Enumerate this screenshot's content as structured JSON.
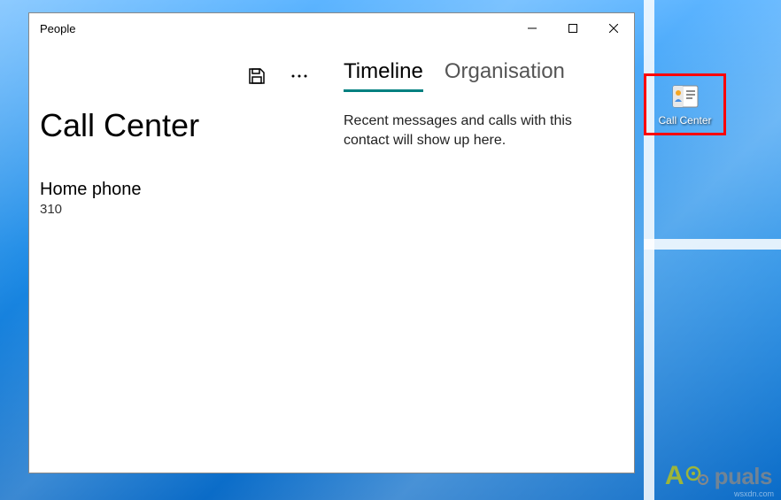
{
  "app": {
    "title": "People"
  },
  "contact": {
    "name": "Call Center",
    "fields": [
      {
        "label": "Home phone",
        "value": "310"
      }
    ]
  },
  "tabs": {
    "timeline": "Timeline",
    "organisation": "Organisation"
  },
  "timeline_content": "Recent messages and calls with this contact will show up here.",
  "desktop_icon": {
    "label": "Call Center"
  },
  "watermark": {
    "brand": "puals",
    "site": "wsxdn.com"
  }
}
